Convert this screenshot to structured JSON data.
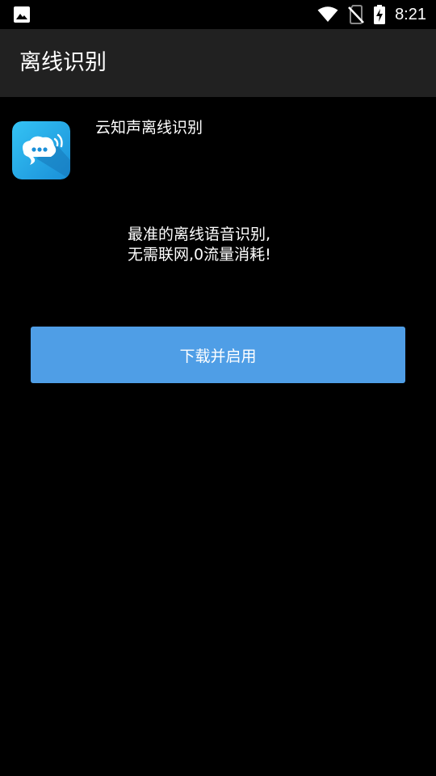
{
  "status_bar": {
    "time": "8:21",
    "icons": [
      "image-icon",
      "wifi-icon",
      "no-sim-icon",
      "battery-charging-icon"
    ]
  },
  "app_bar": {
    "title": "离线识别"
  },
  "app": {
    "name": "云知声离线识别",
    "icon": "chat-bubble-icon"
  },
  "description": {
    "line1": "最准的离线语音识别,",
    "line2": "无需联网,0流量消耗!"
  },
  "download_button": {
    "label": "下载并启用",
    "color": "#4f9ee6"
  },
  "colors": {
    "background": "#000000",
    "app_bar": "#212121",
    "accent": "#4f9ee6"
  }
}
